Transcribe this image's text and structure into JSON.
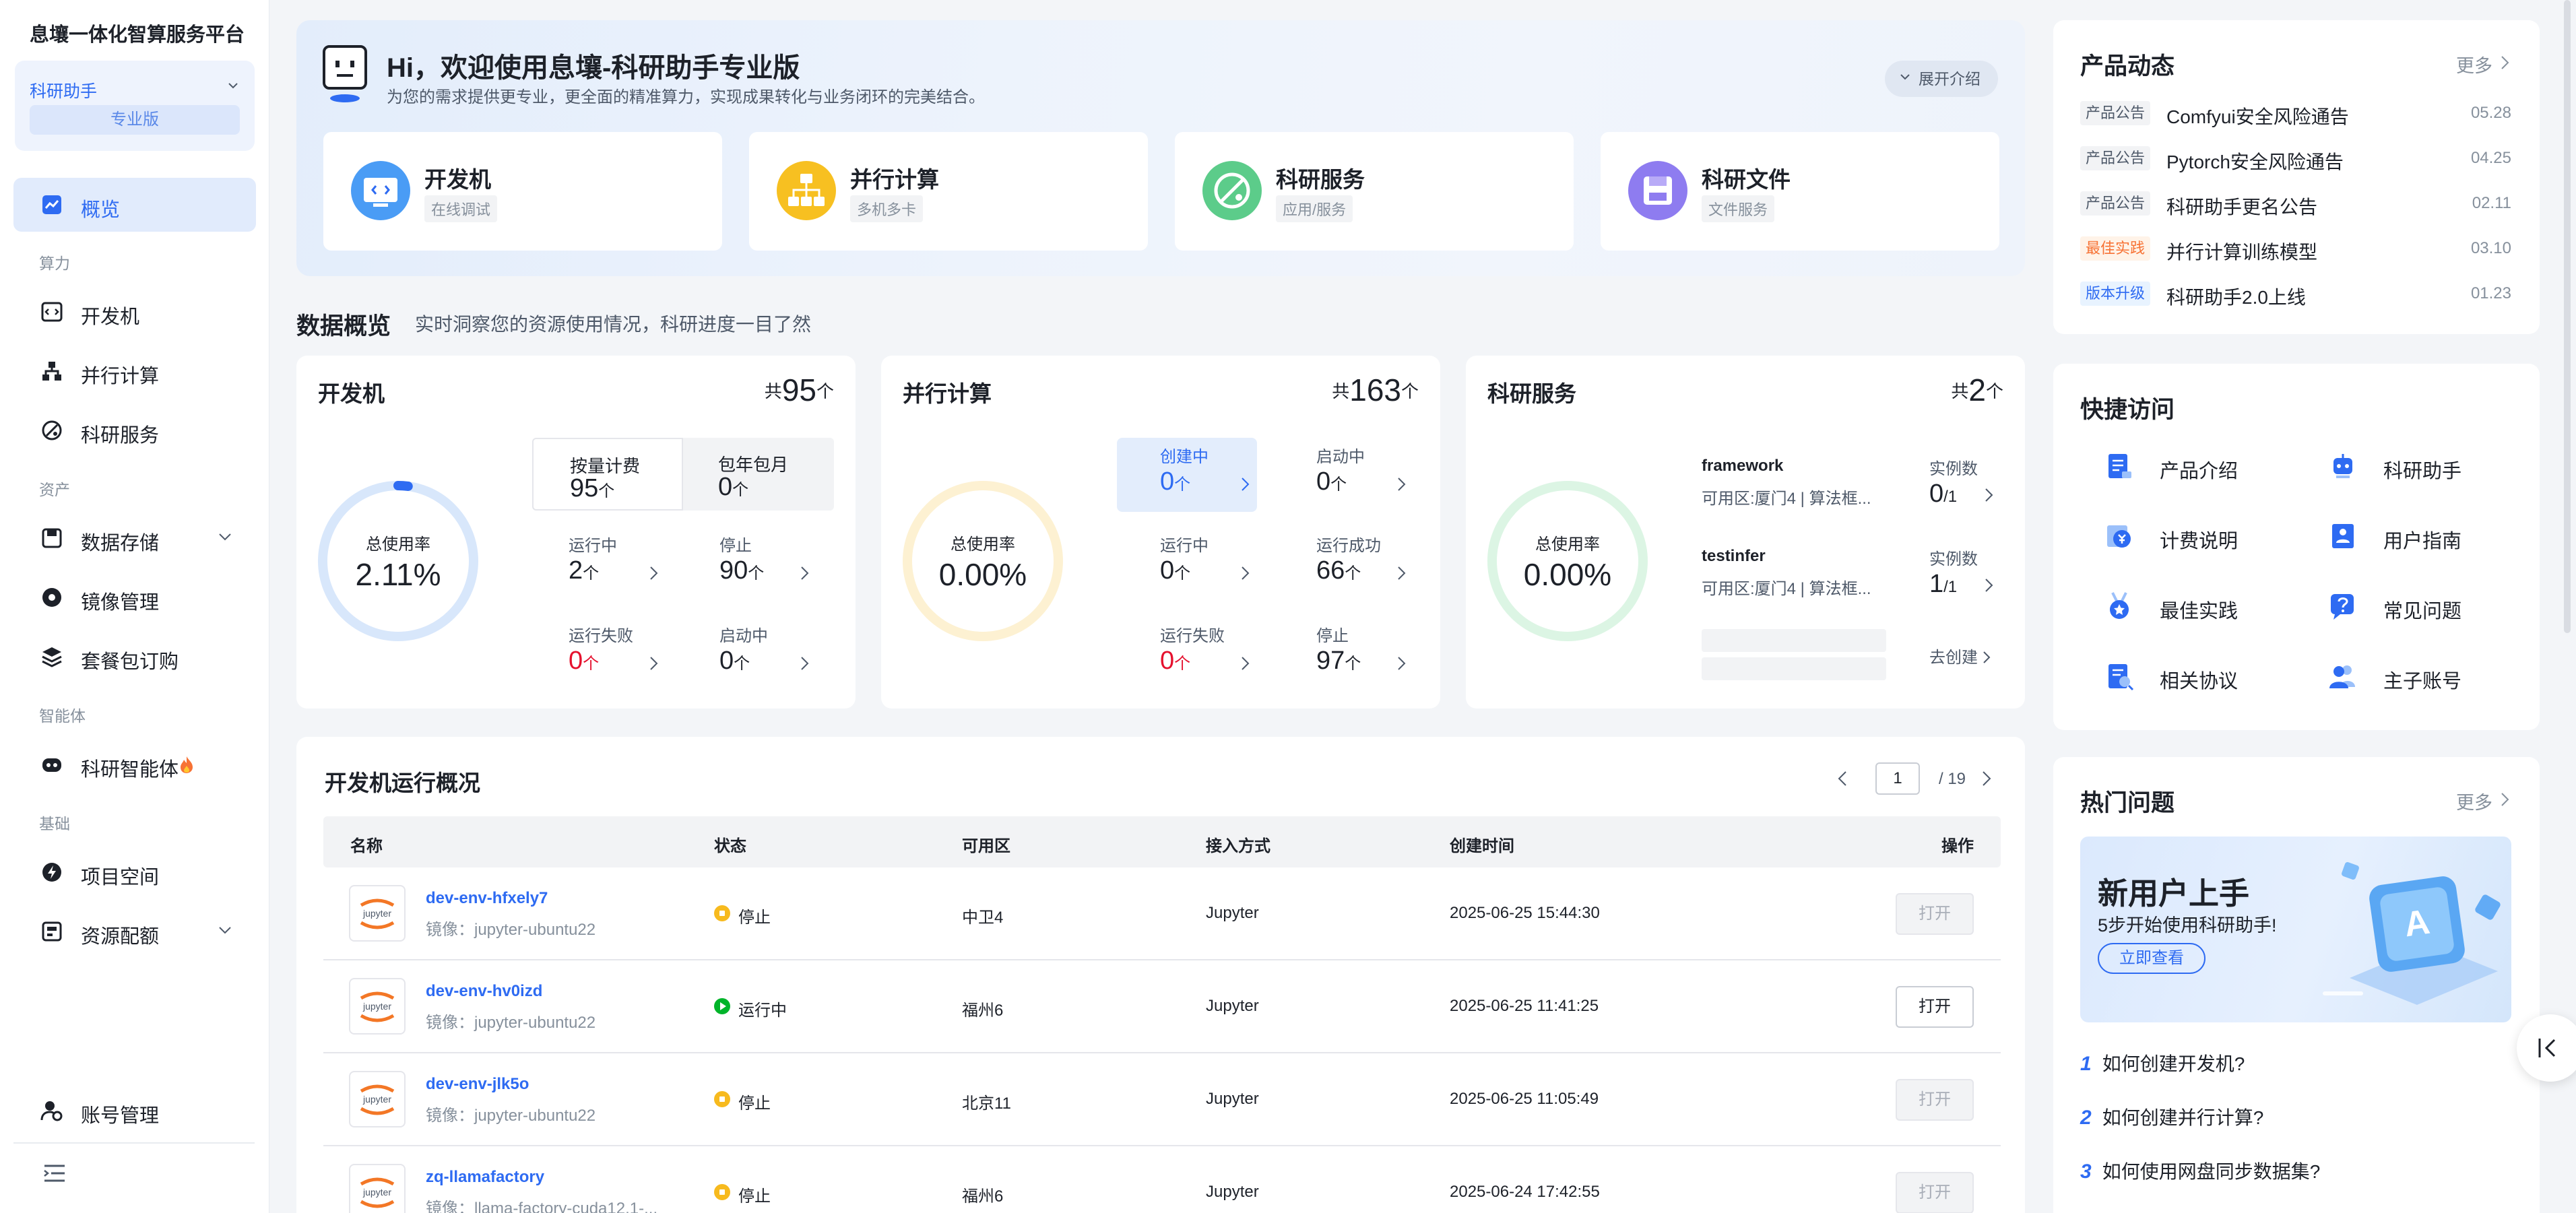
{
  "brand": "息壤一体化智算服务平台",
  "workspace": {
    "name": "科研助手",
    "badge": "专业版"
  },
  "nav": {
    "overview": "概览",
    "group_compute": "算力",
    "devmachine": "开发机",
    "parallel": "并行计算",
    "research_service": "科研服务",
    "group_assets": "资产",
    "data_storage": "数据存储",
    "image_mgmt": "镜像管理",
    "package_order": "套餐包订购",
    "group_agent": "智能体",
    "research_agent": "科研智能体",
    "group_base": "基础",
    "project_space": "项目空间",
    "resource_quota": "资源配额",
    "account_mgmt": "账号管理"
  },
  "hero": {
    "title": "Hi，欢迎使用息壤-科研助手专业版",
    "subtitle": "为您的需求提供更专业，更全面的精准算力，实现成果转化与业务闭环的完美结合。",
    "expand": "展开介绍",
    "features": [
      {
        "name": "开发机",
        "desc": "在线调试"
      },
      {
        "name": "并行计算",
        "desc": "多机多卡"
      },
      {
        "name": "科研服务",
        "desc": "应用/服务"
      },
      {
        "name": "科研文件",
        "desc": "文件服务"
      }
    ]
  },
  "overview": {
    "title": "数据概览",
    "subtitle": "实时洞察您的资源使用情况，科研进度一目了然",
    "unit": "个",
    "total_prefix": "共",
    "usage_label": "总使用率",
    "dev": {
      "title": "开发机",
      "total": "95",
      "usage": "2.11%",
      "usage_fraction": 0.0211,
      "tab_payg": "按量计费",
      "payg_count": "95",
      "tab_monthly": "包年包月",
      "monthly_count": "0",
      "running_label": "运行中",
      "running": "2",
      "stopped_label": "停止",
      "stopped": "90",
      "failed_label": "运行失败",
      "failed": "0",
      "starting_label": "启动中",
      "starting": "0"
    },
    "parallel": {
      "title": "并行计算",
      "total": "163",
      "usage": "0.00%",
      "usage_fraction": 0,
      "creating_label": "创建中",
      "creating": "0",
      "starting_label": "启动中",
      "starting": "0",
      "running_label": "运行中",
      "running": "0",
      "success_label": "运行成功",
      "success": "66",
      "failed_label": "运行失败",
      "failed": "0",
      "stopped_label": "停止",
      "stopped": "97"
    },
    "service": {
      "title": "科研服务",
      "total": "2",
      "usage": "0.00%",
      "usage_fraction": 0,
      "instance_label": "实例数",
      "items": [
        {
          "name": "framework",
          "desc": "可用区:厦门4 | 算法框...",
          "count": "0",
          "of": "/1"
        },
        {
          "name": "testinfer",
          "desc": "可用区:厦门4 | 算法框...",
          "count": "1",
          "of": "/1"
        }
      ],
      "create": "去创建"
    }
  },
  "table": {
    "title": "开发机运行概况",
    "page": "1",
    "total_pages": "/ 19",
    "headers": {
      "name": "名称",
      "status": "状态",
      "zone": "可用区",
      "access": "接入方式",
      "created": "创建时间",
      "action": "操作"
    },
    "logo_text": "jupyter",
    "rows": [
      {
        "name": "dev-env-hfxely7",
        "image": "镜像：jupyter-ubuntu22",
        "status": "停止",
        "zone": "中卫4",
        "access": "Jupyter",
        "created": "2025-06-25 15:44:30",
        "action": "打开"
      },
      {
        "name": "dev-env-hv0izd",
        "image": "镜像：jupyter-ubuntu22",
        "status": "运行中",
        "zone": "福州6",
        "access": "Jupyter",
        "created": "2025-06-25 11:41:25",
        "action": "打开"
      },
      {
        "name": "dev-env-jlk5o",
        "image": "镜像：jupyter-ubuntu22",
        "status": "停止",
        "zone": "北京11",
        "access": "Jupyter",
        "created": "2025-06-25 11:05:49",
        "action": "打开"
      },
      {
        "name": "zq-llamafactory",
        "image": "镜像：llama-factory-cuda12.1-...",
        "status": "停止",
        "zone": "福州6",
        "access": "Jupyter",
        "created": "2025-06-24 17:42:55",
        "action": "打开"
      }
    ]
  },
  "news": {
    "title": "产品动态",
    "more": "更多",
    "items": [
      {
        "tag": "产品公告",
        "text": "Comfyui安全风险通告",
        "date": "05.28"
      },
      {
        "tag": "产品公告",
        "text": "Pytorch安全风险通告",
        "date": "04.25"
      },
      {
        "tag": "产品公告",
        "text": "科研助手更名公告",
        "date": "02.11"
      },
      {
        "tag": "最佳实践",
        "text": "并行计算训练模型",
        "date": "03.10"
      },
      {
        "tag": "版本升级",
        "text": "科研助手2.0上线",
        "date": "01.23"
      }
    ]
  },
  "quick": {
    "title": "快捷访问",
    "items": [
      "产品介绍",
      "科研助手",
      "计费说明",
      "用户指南",
      "最佳实践",
      "常见问题",
      "相关协议",
      "主子账号"
    ]
  },
  "hot": {
    "title": "热门问题",
    "more": "更多",
    "banner_title": "新用户上手",
    "banner_sub": "5步开始使用科研助手!",
    "banner_btn": "立即查看",
    "questions": [
      {
        "num": "1",
        "text": "如何创建开发机?"
      },
      {
        "num": "2",
        "text": "如何创建并行计算?"
      },
      {
        "num": "3",
        "text": "如何使用网盘同步数据集?"
      }
    ]
  }
}
